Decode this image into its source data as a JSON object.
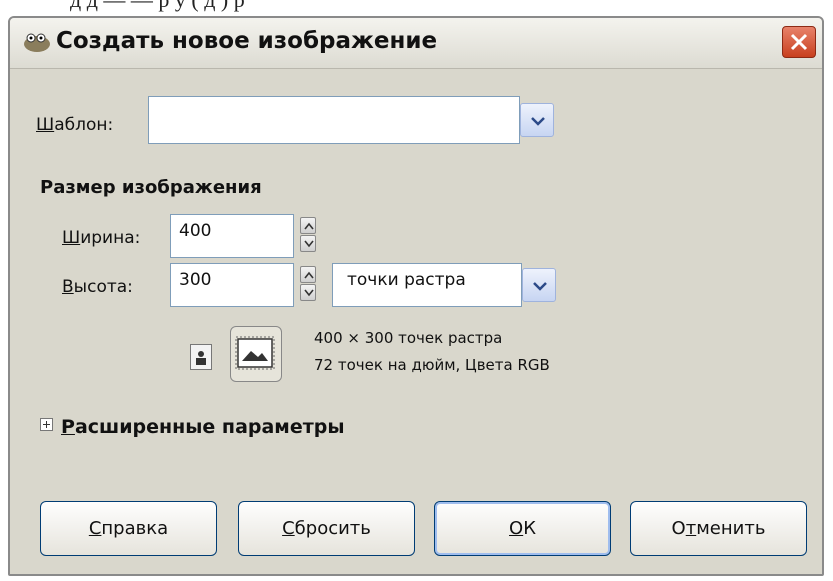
{
  "dialog": {
    "title": "Создать новое изображение"
  },
  "template": {
    "label_underlined": "Ш",
    "label_rest": "аблон:",
    "value": ""
  },
  "image_size": {
    "heading": "Размер изображения",
    "width": {
      "label_underlined": "Ш",
      "label_rest": "ирина:",
      "value": "400"
    },
    "height": {
      "label_underlined": "В",
      "label_rest": "ысота:",
      "value": "300"
    },
    "unit": "точки растра",
    "info_line1": "400 × 300 точек растра",
    "info_line2": "72 точек на дюйм, Цвета RGB"
  },
  "advanced": {
    "label_underlined": "Р",
    "label_rest": "асширенные параметры"
  },
  "buttons": {
    "help": {
      "u": "С",
      "rest": "правка"
    },
    "reset": {
      "u": "С",
      "rest": "бросить"
    },
    "ok": {
      "pre": "",
      "u": "О",
      "rest": "К"
    },
    "cancel": {
      "pre": "О",
      "u": "т",
      "rest": "менить"
    }
  },
  "colors": {
    "dialog_bg": "#d9d7cc",
    "close_button": "#c8401f",
    "button_border": "#003c74"
  },
  "icons": [
    "app-icon",
    "close-icon",
    "chevron-down-icon",
    "spin-up-icon",
    "spin-down-icon",
    "portrait-icon",
    "landscape-icon",
    "expand-plus-icon"
  ]
}
